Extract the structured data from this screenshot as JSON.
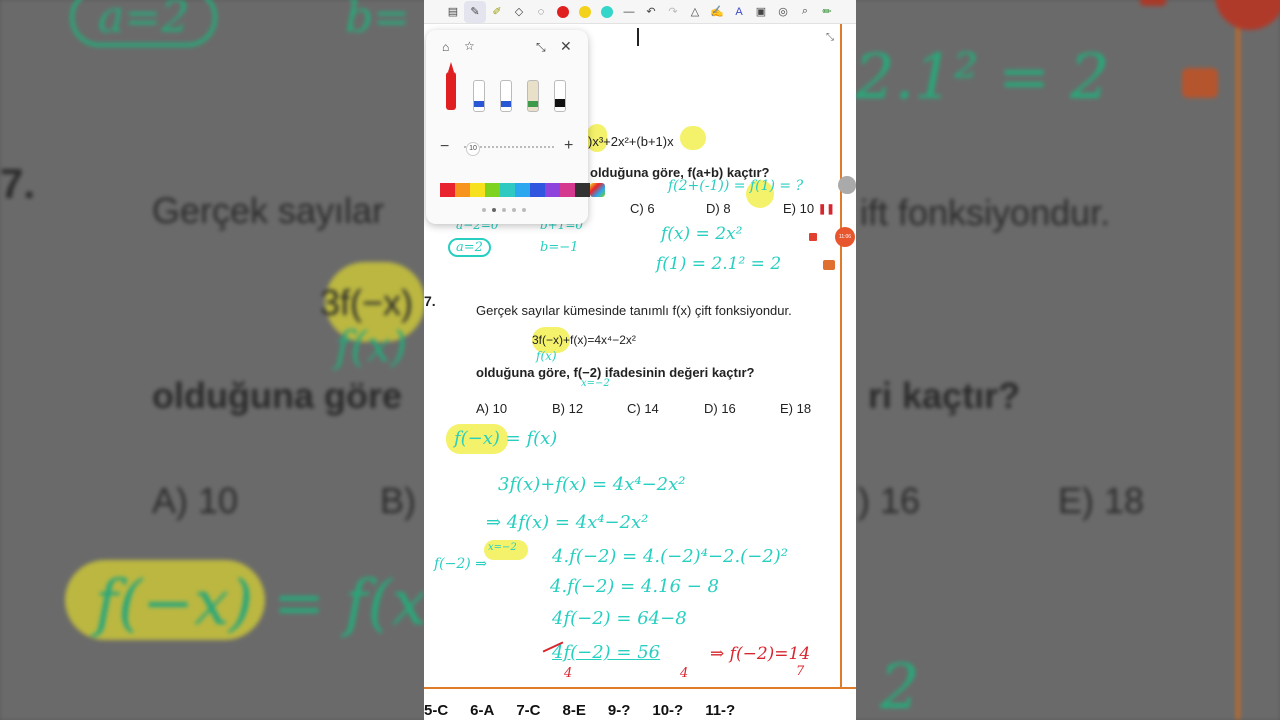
{
  "background": {
    "q_number": "7.",
    "text_line1": "Gerçek sayılar",
    "text_line1_right": "ift fonksiyondur.",
    "expr_left": "3f(−x)",
    "expr_under": "f(x)",
    "text_line3": "olduğuna göre",
    "text_line3_right": "ri kaçtır?",
    "choice_a": "A) 10",
    "choice_b": "B)",
    "choice_d": ") 16",
    "choice_e": "E) 18",
    "hw_top_left": "a=2",
    "hw_top_mid": "b=",
    "hw_top_right": "2.1² = 2",
    "hw_bottom": "f(−x) = f(x",
    "hw_bottom_right": "2"
  },
  "toolbar": {
    "icons": [
      "document-icon",
      "pen-icon",
      "highlighter-icon",
      "eraser-icon",
      "lasso-icon"
    ],
    "colors": [
      "#e02020",
      "#f2d21a",
      "#33d6c8"
    ],
    "icons_right": [
      "line-icon",
      "undo-icon",
      "redo-icon",
      "shape-icon",
      "text-edit-icon",
      "text-style-icon",
      "insert-icon",
      "shapes-icon",
      "search-icon",
      "pencil-icon"
    ]
  },
  "pen_popup": {
    "size_value": "10",
    "minus": "−",
    "plus": "+",
    "swatch_colors": [
      "#e8232e",
      "#f7941d",
      "#f7e01d",
      "#7ed321",
      "#2ec9c0",
      "#2aa7ee",
      "#3056e0",
      "#8e44dc",
      "#d5398f",
      "#333333"
    ]
  },
  "question6": {
    "expr": ")x³+2x²+(b+1)x",
    "prompt": "olduğuna göre, f(a+b) kaçtır?",
    "choice_c": "C) 6",
    "choice_d": "D) 8",
    "choice_e": "E) 10"
  },
  "hw6": {
    "fab": "f(2+(-1)) = f(1) = ?",
    "a_eq": "a−2=0",
    "a_val": "a=2",
    "b_eq": "b+1=0",
    "b_val": "b=−1",
    "fx": "f(x) = 2x²",
    "f1": "f(1) = 2.1² = 2"
  },
  "question7": {
    "number": "7.",
    "statement": "Gerçek sayılar kümesinde tanımlı f(x) çift fonksiyondur.",
    "equation": "3f(−x)+f(x)=4x⁴−2x²",
    "prompt": "olduğuna göre, f(−2) ifadesinin değeri kaçtır?",
    "choices": [
      "A) 10",
      "B) 12",
      "C) 14",
      "D) 16",
      "E) 18"
    ]
  },
  "hw7": {
    "under_expr": "f(x)",
    "under_prompt": "x=−2",
    "even": "f(−x) = f(x)",
    "line1": "3f(x)+f(x) = 4x⁴−2x²",
    "line2": "⇒ 4f(x) = 4x⁴−2x²",
    "left_label": "f(−2) ⇒",
    "left_hl": "x=−2",
    "line3": "4.f(−2) = 4.(−2)⁴−2.(−2)²",
    "line4": "4.f(−2) = 4.16 − 8",
    "line5": "4f(−2) = 64−8",
    "line6": "4f(−2) = 56",
    "denom1": "4",
    "denom2": "4",
    "result": "⇒ f(−2)=14",
    "result_sub": "7"
  },
  "answer_key": [
    "5-C",
    "6-A",
    "7-C",
    "8-E",
    "9-?",
    "10-?",
    "11-?"
  ],
  "recording": {
    "time": "11:06"
  }
}
